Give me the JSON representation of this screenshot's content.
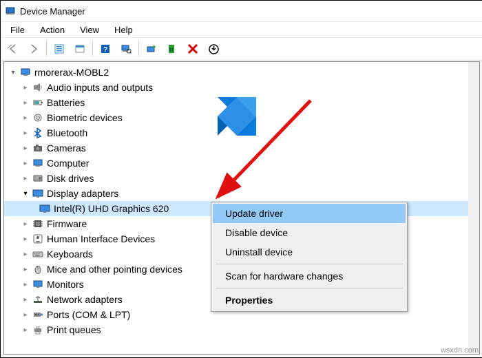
{
  "title": "Device Manager",
  "menu": [
    "File",
    "Action",
    "View",
    "Help"
  ],
  "root": "rmorerax-MOBL2",
  "cats": [
    {
      "label": "Audio inputs and outputs",
      "exp": false
    },
    {
      "label": "Batteries",
      "exp": false
    },
    {
      "label": "Biometric devices",
      "exp": false
    },
    {
      "label": "Bluetooth",
      "exp": false
    },
    {
      "label": "Cameras",
      "exp": false
    },
    {
      "label": "Computer",
      "exp": false
    },
    {
      "label": "Disk drives",
      "exp": false
    },
    {
      "label": "Display adapters",
      "exp": true
    },
    {
      "label": "Firmware",
      "exp": false
    },
    {
      "label": "Human Interface Devices",
      "exp": false
    },
    {
      "label": "Keyboards",
      "exp": false
    },
    {
      "label": "Mice and other pointing devices",
      "exp": false
    },
    {
      "label": "Monitors",
      "exp": false
    },
    {
      "label": "Network adapters",
      "exp": false
    },
    {
      "label": "Ports (COM & LPT)",
      "exp": false
    },
    {
      "label": "Print queues",
      "exp": false
    }
  ],
  "selected_device": "Intel(R) UHD Graphics 620",
  "context": {
    "update": "Update driver",
    "disable": "Disable device",
    "uninstall": "Uninstall device",
    "scan": "Scan for hardware changes",
    "props": "Properties"
  },
  "watermark": "wsxdn.com"
}
